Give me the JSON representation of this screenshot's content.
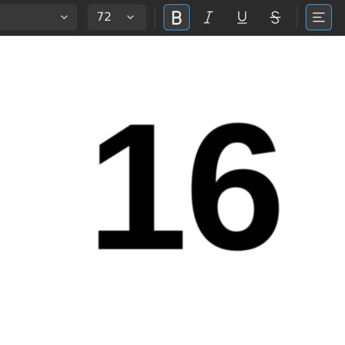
{
  "toolbar": {
    "font_family": {
      "value": "",
      "icon": "chevron-down-icon"
    },
    "font_size": {
      "value": "72",
      "icon": "chevron-down-icon"
    },
    "buttons": [
      {
        "name": "bold",
        "icon": "bold-icon",
        "active": true
      },
      {
        "name": "italic",
        "icon": "italic-icon",
        "active": false
      },
      {
        "name": "underline",
        "icon": "underline-icon",
        "active": false
      },
      {
        "name": "strikethrough",
        "icon": "strikethrough-icon",
        "active": false
      },
      {
        "name": "align",
        "icon": "align-left-icon",
        "active": true
      }
    ],
    "colors": {
      "background": "#2b2b2b",
      "control": "#383838",
      "active_border": "#4a9fe0",
      "icon": "#e6e6e6"
    }
  },
  "document": {
    "content": "16",
    "text_color": "#000000",
    "background": "#ffffff"
  }
}
